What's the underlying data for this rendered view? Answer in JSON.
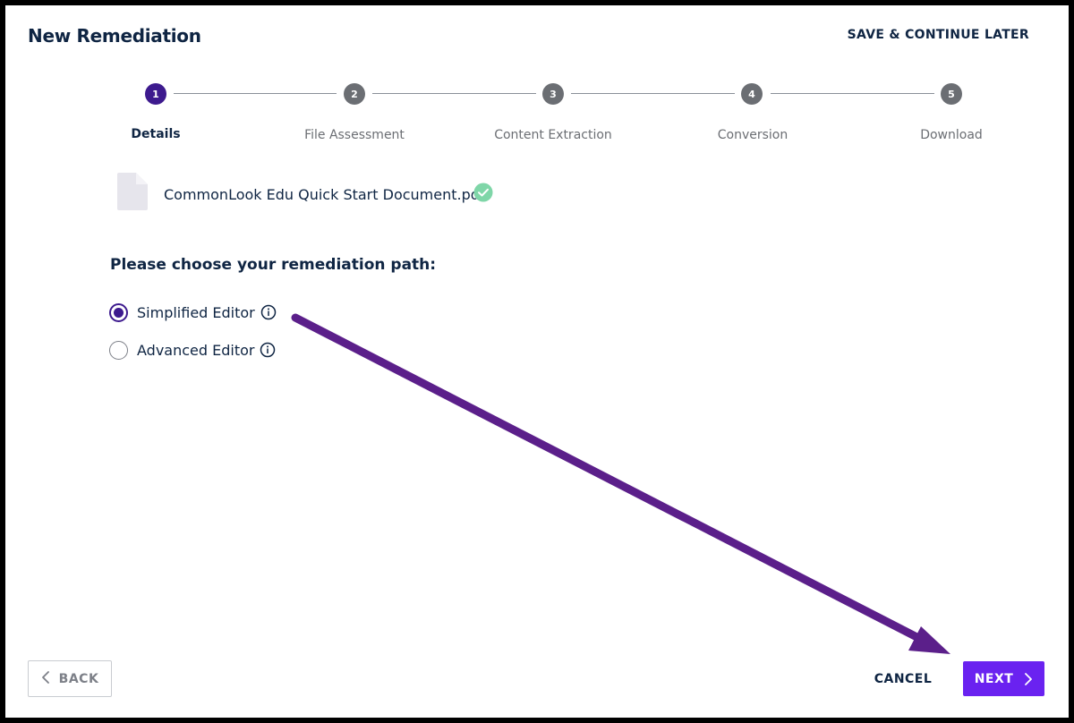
{
  "header": {
    "title": "New Remediation",
    "save_later_label": "SAVE & CONTINUE LATER"
  },
  "stepper": {
    "steps": [
      {
        "number": "1",
        "label": "Details",
        "active": true
      },
      {
        "number": "2",
        "label": "File Assessment",
        "active": false
      },
      {
        "number": "3",
        "label": "Content Extraction",
        "active": false
      },
      {
        "number": "4",
        "label": "Conversion",
        "active": false
      },
      {
        "number": "5",
        "label": "Download",
        "active": false
      }
    ]
  },
  "file": {
    "name": "CommonLook Edu Quick Start Document.pdf",
    "icon": "document-icon",
    "status_icon": "check-circle-icon"
  },
  "path": {
    "heading": "Please choose your remediation path:",
    "options": [
      {
        "label": "Simplified Editor",
        "selected": true,
        "icon": "info-icon"
      },
      {
        "label": "Advanced Editor",
        "selected": false,
        "icon": "info-icon"
      }
    ]
  },
  "footer": {
    "back_label": "BACK",
    "cancel_label": "CANCEL",
    "next_label": "NEXT"
  },
  "colors": {
    "accent": "#6a22f0",
    "active_step": "#3d1a8e",
    "inactive_step": "#6b6e73",
    "success": "#7fd6a8",
    "annotation_arrow": "#5b1f8a"
  }
}
